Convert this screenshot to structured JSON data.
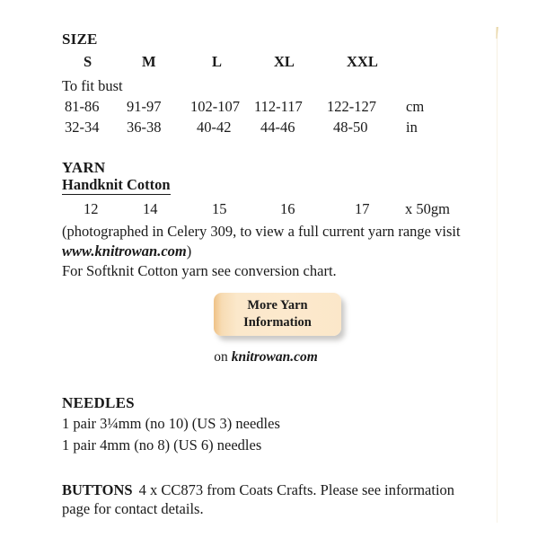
{
  "document": {
    "type": "knitting-pattern-info-page"
  },
  "size_section": {
    "heading": "SIZE",
    "size_labels": [
      "S",
      "M",
      "L",
      "XL",
      "XXL"
    ],
    "to_fit_label": "To fit bust",
    "measurements": [
      {
        "unit": "cm",
        "values": [
          "81-86",
          "91-97",
          "102-107",
          "112-117",
          "122-127"
        ]
      },
      {
        "unit": "in",
        "values": [
          "32-34",
          "36-38",
          "40-42",
          "44-46",
          "48-50"
        ]
      }
    ]
  },
  "yarn_section": {
    "heading": "YARN",
    "yarn_name": "Handknit Cotton",
    "ball_counts": [
      "12",
      "14",
      "15",
      "16",
      "17"
    ],
    "ball_unit": "x 50gm",
    "note_line_1": "(photographed in Celery 309, to view a full current yarn range visit",
    "note_site": "www.knitrowan.com",
    "note_close": ")",
    "conversion_note": "For Softknit Cotton yarn see conversion chart."
  },
  "yarn_button": {
    "label_line_1": "More Yarn",
    "label_line_2": "Information",
    "caption_prefix": "on",
    "caption_domain": "knitrowan.com",
    "gradient_start": "#efc287",
    "gradient_end": "#fbe7c9"
  },
  "needles_section": {
    "heading": "NEEDLES",
    "items": [
      "1 pair 3¼mm (no 10) (US 3) needles",
      "1 pair 4mm (no 8) (US 6) needles"
    ]
  },
  "buttons_section": {
    "heading": "BUTTONS",
    "text_line_1": "4 x CC873 from Coats Crafts. Please see information",
    "text_line_2": "page for contact details."
  }
}
